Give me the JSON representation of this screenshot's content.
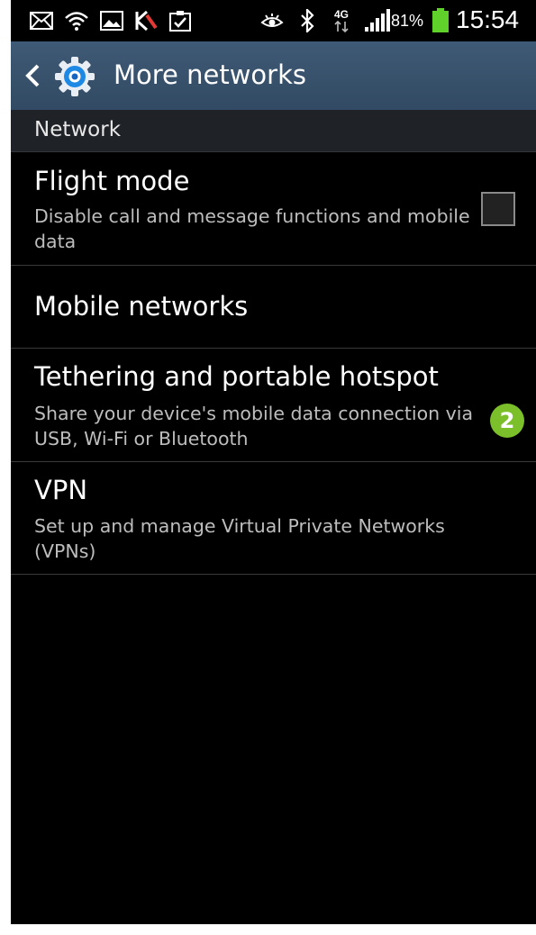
{
  "status_bar": {
    "battery_percent": "81%",
    "time": "15:54",
    "network_type": "4G",
    "icons": [
      "mail-icon",
      "wifi-calling-icon",
      "image-icon",
      "kaspersky-icon",
      "clipboard-check-icon",
      "eye-icon",
      "bluetooth-icon",
      "network-4g-icon",
      "signal-icon",
      "battery-icon"
    ]
  },
  "action_bar": {
    "title": "More networks",
    "back_icon": "chevron-left-icon",
    "app_icon": "settings-gear-icon"
  },
  "section": {
    "label": "Network"
  },
  "items": [
    {
      "title": "Flight mode",
      "summary": "Disable call and message functions and mobile data",
      "checkbox_checked": false
    },
    {
      "title": "Mobile networks"
    },
    {
      "title": "Tethering and portable hotspot",
      "summary": "Share your device's mobile data connection via USB, Wi-Fi or Bluetooth"
    },
    {
      "title": "VPN",
      "summary": "Set up and manage Virtual Private Networks (VPNs)"
    }
  ],
  "annotation_badge": "2",
  "colors": {
    "action_bar": "#3a5370",
    "background": "#000000",
    "badge": "#7bbf2a",
    "battery": "#5fd12a"
  }
}
